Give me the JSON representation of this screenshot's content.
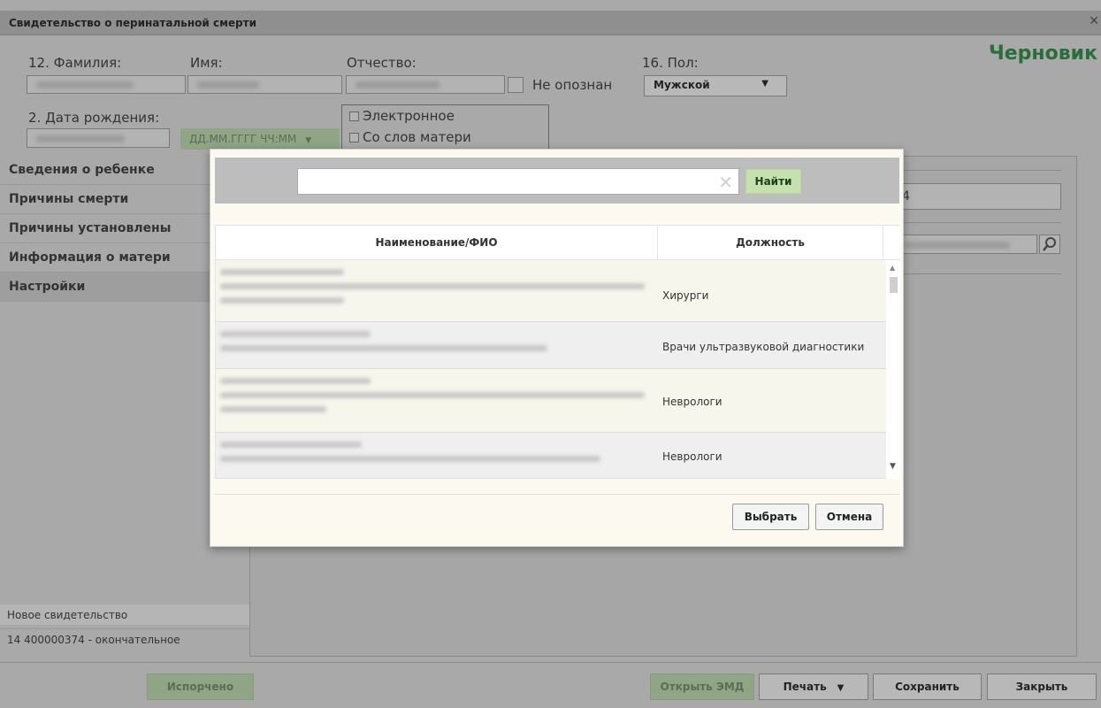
{
  "window": {
    "title": "Свидетельство о перинатальной смерти",
    "status": "Черновик"
  },
  "fields": {
    "surname_label": "12. Фамилия:",
    "name_label": "Имя:",
    "patronymic_label": "Отчество:",
    "unidentified_label": "Не опознан",
    "sex_label": "16. Пол:",
    "sex_value": "Мужской",
    "birthdate_label": "2. Дата рождения:",
    "datetime_placeholder": "ДД.ММ.ГГГГ ЧЧ:ММ",
    "electronic_label": "Электронное",
    "from_mother_label": "Со слов матери",
    "right_input_value": "4"
  },
  "nav": {
    "items": [
      {
        "label": "Сведения о ребенке"
      },
      {
        "label": "Причины смерти"
      },
      {
        "label": "Причины установлены"
      },
      {
        "label": "Информация о матери"
      },
      {
        "label": "Настройки"
      }
    ]
  },
  "certificates": {
    "new": "Новое свидетельство",
    "final": "14 400000374 - окончательное"
  },
  "footer": {
    "spoiled": "Испорчено",
    "open_emd": "Открыть ЭМД",
    "print": "Печать",
    "save": "Сохранить",
    "close": "Закрыть"
  },
  "modal": {
    "search_value": "",
    "find_button": "Найти",
    "columns": {
      "name": "Наименование/ФИО",
      "position": "Должность"
    },
    "rows": [
      {
        "position": "Хирурги"
      },
      {
        "position": "Врачи ультразвуковой диагностики"
      },
      {
        "position": "Неврологи"
      },
      {
        "position": "Неврологи"
      }
    ],
    "select_button": "Выбрать",
    "cancel_button": "Отмена"
  }
}
